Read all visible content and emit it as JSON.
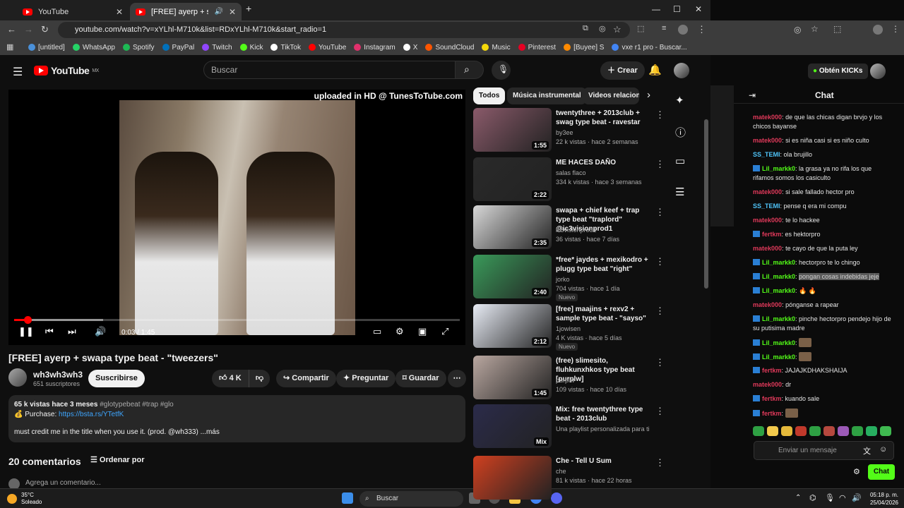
{
  "browser": {
    "tabs": [
      {
        "title": "YouTube"
      },
      {
        "title": "[FREE] ayerp + swapa type b"
      }
    ],
    "new_tab": "+",
    "url": "youtube.com/watch?v=xYLhl-M710k&list=RDxYLhl-M710k&start_radio=1",
    "bookmarks": [
      {
        "label": "[untitled]",
        "color": "#4a90d9"
      },
      {
        "label": "WhatsApp",
        "color": "#25d366"
      },
      {
        "label": "Spotify",
        "color": "#1db954"
      },
      {
        "label": "PayPal",
        "color": "#0070ba"
      },
      {
        "label": "Twitch",
        "color": "#9146ff"
      },
      {
        "label": "Kick",
        "color": "#53fc18"
      },
      {
        "label": "TikTok",
        "color": "#ffffff"
      },
      {
        "label": "YouTube",
        "color": "#ff0000"
      },
      {
        "label": "Instagram",
        "color": "#e1306c"
      },
      {
        "label": "X",
        "color": "#ffffff"
      },
      {
        "label": "SoundCloud",
        "color": "#ff5500"
      },
      {
        "label": "Music",
        "color": "#f5d90a"
      },
      {
        "label": "Pinterest",
        "color": "#e60023"
      },
      {
        "label": "[Buyee] S",
        "color": "#ff8a00"
      },
      {
        "label": "vxe r1 pro - Buscar...",
        "color": "#4285f4"
      }
    ]
  },
  "youtube": {
    "logo": "YouTube",
    "region": "MX",
    "search_placeholder": "Buscar",
    "create_label": "Crear",
    "player": {
      "overlay_text": "uploaded in HD @ TunesToTube.com",
      "current_time": "0:03 / 1:45",
      "progress_fraction": 0.03,
      "buffered_fraction": 0.2
    },
    "video_title": "[FREE] ayerp + swapa type beat - \"tweezers\"",
    "channel": {
      "name": "wh3wh3wh3",
      "subscribers": "651 suscriptores"
    },
    "subscribe_label": "Suscribirse",
    "actions": {
      "likes": "4 K",
      "share": "Compartir",
      "ask": "Preguntar",
      "save": "Guardar"
    },
    "description": {
      "stats": "65 k vistas  hace 3 meses",
      "tags": "#glotypebeat #trap #glo",
      "purchase_label": "Purchase:",
      "purchase_link": "https://bsta.rs/YTetfK",
      "body": "must credit me in the title when you use it. (prod. @wh333) ...más"
    },
    "comments_count": "20 comentarios",
    "sort_label": "Ordenar por",
    "add_comment": "Agrega un comentario...",
    "chips": [
      "Todos",
      "Música instrumental",
      "Videos relacionados"
    ],
    "related": [
      {
        "title": "twentythree + 2013club + swag type beat - ravestar",
        "channel": "by3ee",
        "meta": "22 k vistas · hace 2 semanas",
        "duration": "1:55",
        "badge": "",
        "color": "#8a5a6a"
      },
      {
        "title": "ME HACES DAÑO",
        "channel": "salas flaco",
        "meta": "334 k vistas · hace 3 semanas",
        "duration": "2:22",
        "badge": "",
        "color": "#2a2a2a"
      },
      {
        "title": "swapa + chief keef + trap type beat \"traplord\" @ic3visionprod1",
        "channel": "ic3visionprod1",
        "meta": "36 vistas · hace 7 días",
        "duration": "2:35",
        "badge": "",
        "color": "#d8d8d8"
      },
      {
        "title": "*free* jaydes + mexikodro + plugg type beat \"right\"",
        "channel": "jorko",
        "meta": "704 vistas · hace 1 día",
        "duration": "2:40",
        "badge": "Nuevo",
        "color": "#3a9a5a"
      },
      {
        "title": "[free] maajins + rexv2 + sample type beat - \"sayso\"",
        "channel": "1jowisen",
        "meta": "4 K vistas · hace 5 días",
        "duration": "2:12",
        "badge": "Nuevo",
        "color": "#e8ecf5"
      },
      {
        "title": "(free) slimesito, fluhkunxhkos type beat [purplw]",
        "channel": "purplw",
        "meta": "109 vistas · hace 10 días",
        "duration": "1:45",
        "badge": "",
        "color": "#b9a7a0"
      },
      {
        "title": "Mix: free twentythree type beat - 2013club",
        "channel": "Una playlist personalizada para ti",
        "meta": "",
        "duration": "Mix",
        "badge": "",
        "color": "#2b2b4a"
      },
      {
        "title": "Che - Tell U Sum",
        "channel": "che",
        "meta": "81 k vistas · hace 22 horas",
        "duration": "",
        "badge": "",
        "color": "#d04020"
      }
    ]
  },
  "kick": {
    "get_kicks": "Obtén KICKs",
    "chat_title": "Chat",
    "messages": [
      {
        "user": "matek000",
        "text": "de que las chicas digan brvjo y los chicos bayanse",
        "color": "#e0395a",
        "badge": false
      },
      {
        "user": "matek000",
        "text": "si es niña casi si es niño culto",
        "color": "#e0395a",
        "badge": false
      },
      {
        "user": "SS_TEMI",
        "text": "ola brujillo",
        "color": "#4fc3f7",
        "badge": false
      },
      {
        "user": "Lil_markk0",
        "text": "la grasa ya no rifa los que rifamos somos los casiculto",
        "color": "#53fc18",
        "badge": true
      },
      {
        "user": "matek000",
        "text": "si sale fallado hector pro",
        "color": "#e0395a",
        "badge": false
      },
      {
        "user": "SS_TEMI",
        "text": "pense q era mi compu",
        "color": "#4fc3f7",
        "badge": false
      },
      {
        "user": "matek000",
        "text": "te lo hackee",
        "color": "#e0395a",
        "badge": false
      },
      {
        "user": "fertkm",
        "text": "es hektorpro",
        "color": "#e0395a",
        "badge": true
      },
      {
        "user": "matek000",
        "text": "te cayo de que la puta ley",
        "color": "#e0395a",
        "badge": false
      },
      {
        "user": "Lil_markk0",
        "text": "hectorpro te lo chingo",
        "color": "#53fc18",
        "badge": true
      },
      {
        "user": "Lil_markk0",
        "text": "pongan cosas indebidas jeje",
        "color": "#53fc18",
        "badge": true
      },
      {
        "user": "Lil_markk0",
        "text": "🔥 🔥",
        "color": "#53fc18",
        "badge": true
      },
      {
        "user": "matek000",
        "text": "pónganse a rapear",
        "color": "#e0395a",
        "badge": false
      },
      {
        "user": "Lil_markk0",
        "text": "pinche hectorpro pendejo hijo de su putisima madre",
        "color": "#53fc18",
        "badge": true
      },
      {
        "user": "Lil_markk0",
        "text": "",
        "color": "#53fc18",
        "badge": true
      },
      {
        "user": "Lil_markk0",
        "text": "",
        "color": "#53fc18",
        "badge": true
      },
      {
        "user": "fertkm",
        "text": "JAJAJKDHAKSHAIJA",
        "color": "#e0395a",
        "badge": true
      },
      {
        "user": "matek000",
        "text": "dr",
        "color": "#e0395a",
        "badge": false
      },
      {
        "user": "fertkm",
        "text": "kuando sale",
        "color": "#e0395a",
        "badge": true
      },
      {
        "user": "fertkm",
        "text": "",
        "color": "#e0395a",
        "badge": true
      }
    ],
    "input_placeholder": "Enviar un mensaje",
    "send_label": "Chat"
  },
  "taskbar": {
    "temperature": "35°C",
    "condition": "Soleado",
    "search": "Buscar",
    "time": "05:18 p. m.",
    "date": "25/04/2026"
  }
}
